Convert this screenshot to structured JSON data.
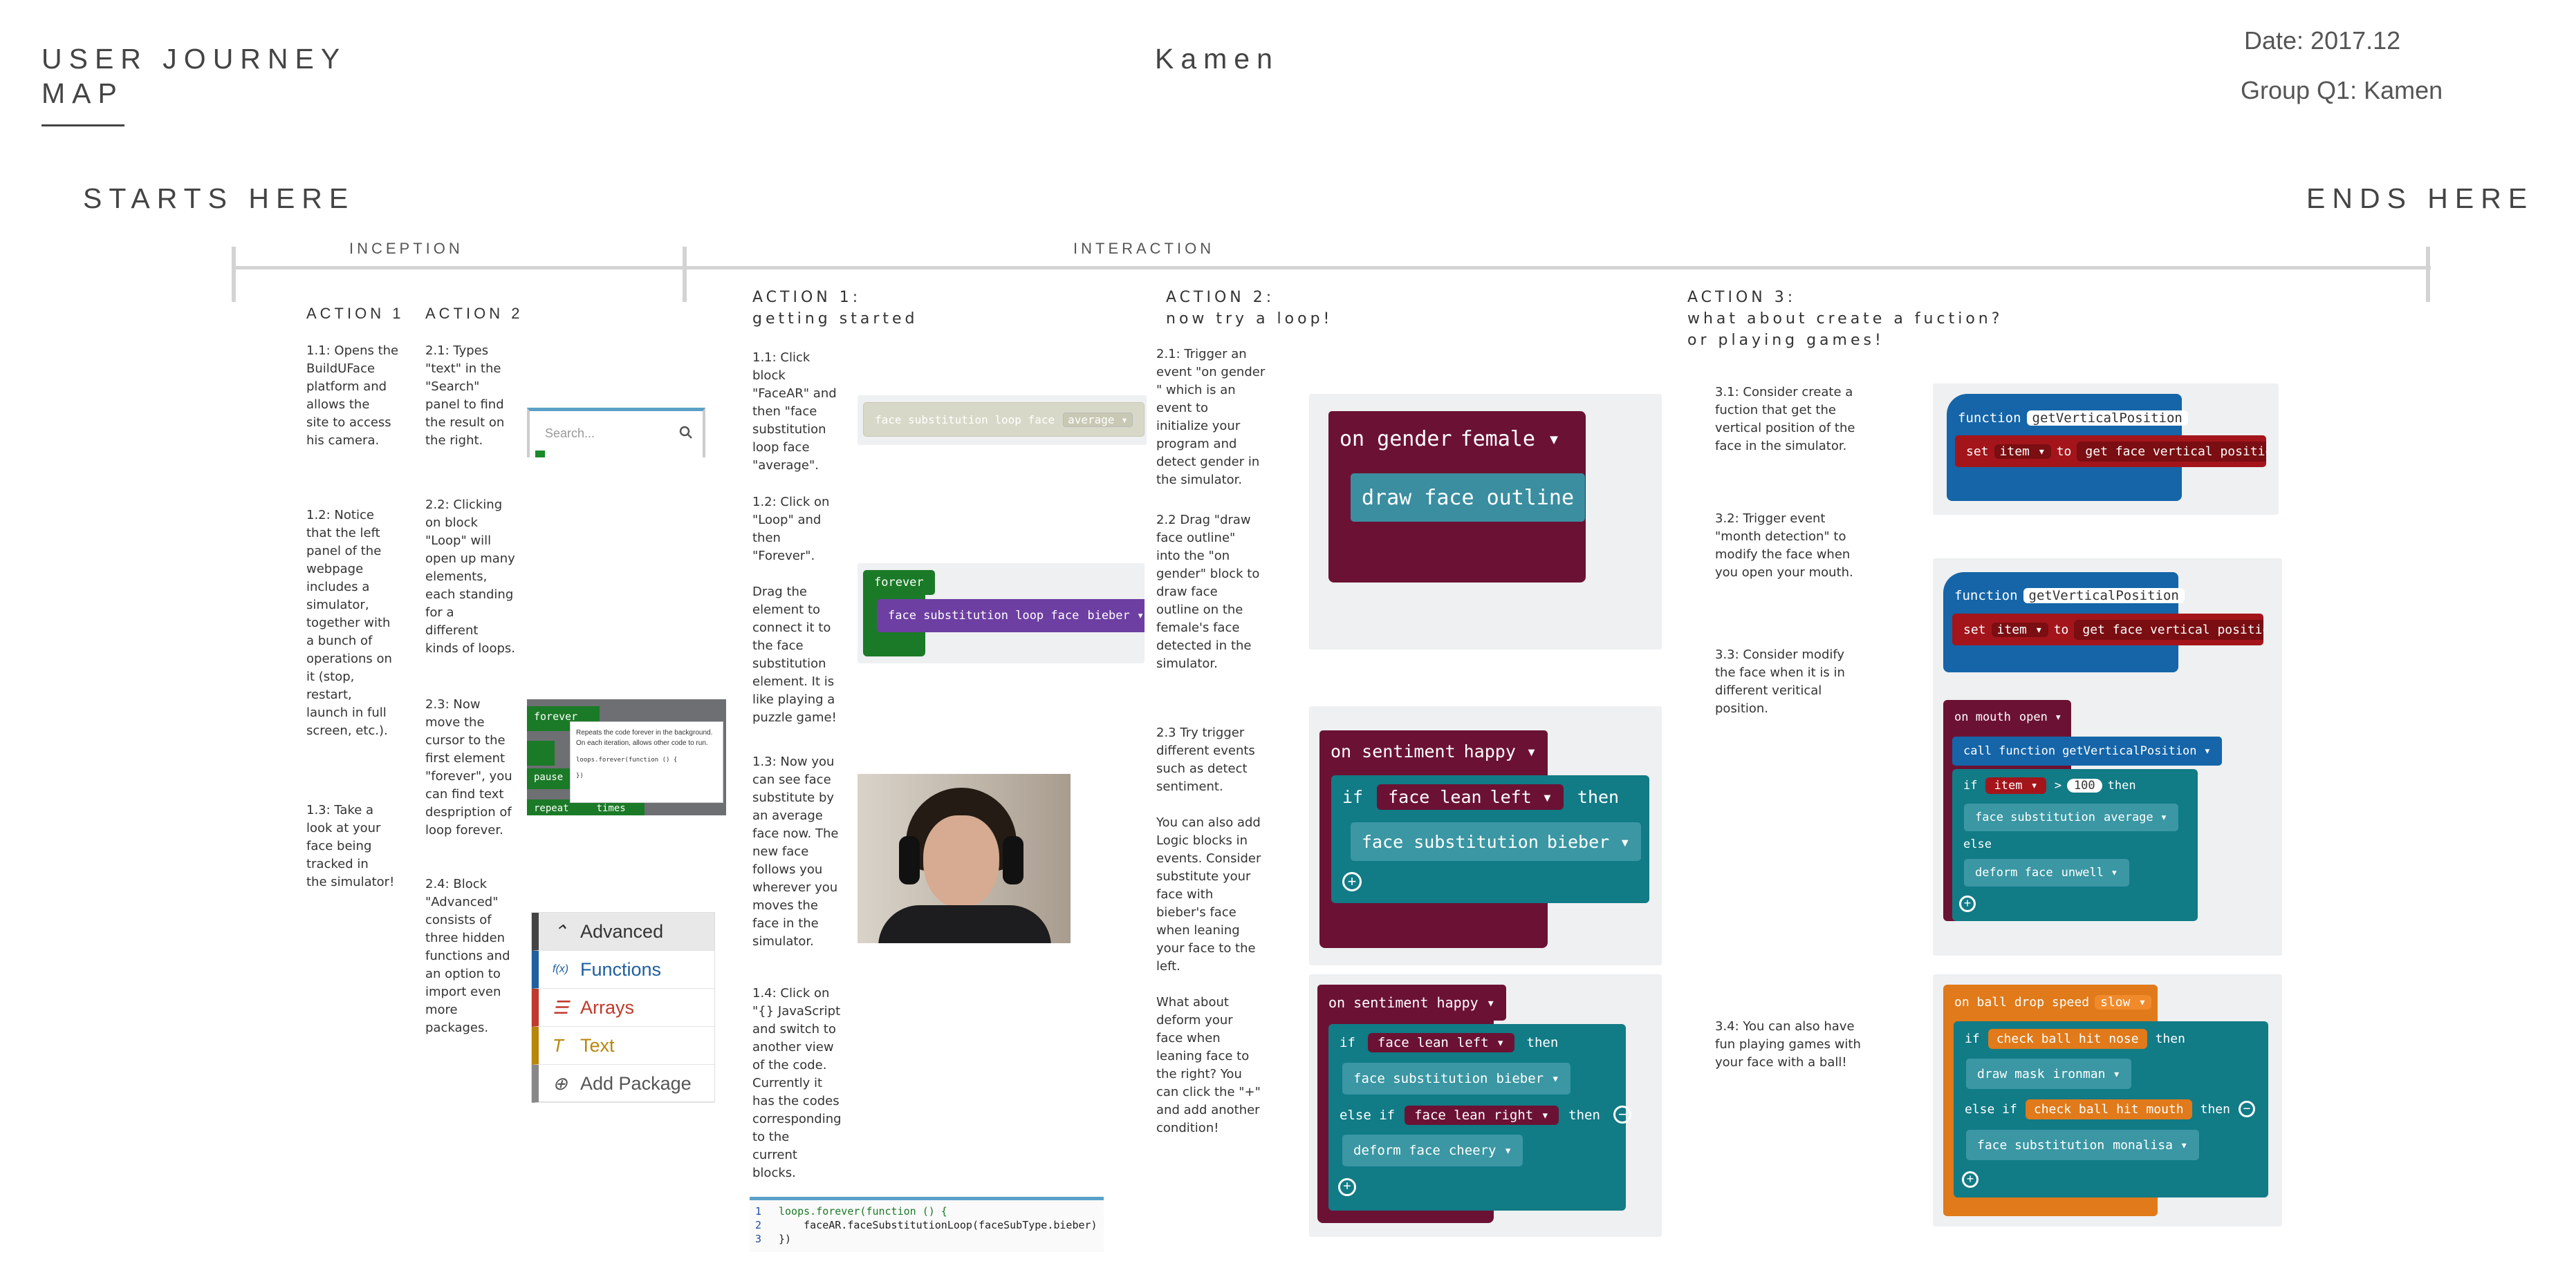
{
  "header": {
    "title": "USER JOURNEY\nMAP",
    "center": "Kamen",
    "date": "Date:   2017.12",
    "group": "Group Q1: Kamen"
  },
  "ends": {
    "start": "STARTS HERE",
    "end": "ENDS HERE"
  },
  "phases": {
    "inception": "INCEPTION",
    "interaction": "INTERACTION"
  },
  "inception": {
    "action1_title": "ACTION 1",
    "action2_title": "ACTION 2",
    "a1_notes": [
      "1.1: Opens the\nBuildUFace\nplatform and\nallows the\nsite to access\nhis camera.",
      "1.2: Notice\nthat the left\npanel of the\nwebpage\nincludes a\nsimulator,\ntogether with\na bunch of\noperations on\nit (stop,\nrestart,\nlaunch in full\nscreen, etc.).",
      "1.3: Take a\nlook at your\nface being\ntracked in\nthe simulator!"
    ],
    "a2_notes": [
      "2.1: Types\n\"text\" in the\n\"Search\"\npanel to find\nthe result on\nthe right.",
      "2.2: Clicking\non block\n\"Loop\" will\nopen up many\nelements,\neach standing\nfor a\ndifferent\nkinds of loops.",
      "2.3: Now\nmove the\ncursor to the\nfirst element\n\"forever\", you\ncan find text\ndespription of\nloop forever.",
      "2.4: Block\n\"Advanced\"\nconsists of\nthree hidden\nfunctions and\nan option to\nimport even\nmore\npackages."
    ],
    "search_placeholder": "Search...",
    "tooltip": {
      "head": "forever",
      "text": "Repeats the code forever in the background. On each iteration, allows other code to run.",
      "code": "loops.forever(function () {",
      "close": "})",
      "labels": [
        "pause",
        "repeat",
        "times"
      ]
    },
    "menu": [
      {
        "icon": "chevron-up-icon",
        "glyph": "⌃",
        "label": "Advanced",
        "color": "#333333",
        "bar": "#444444"
      },
      {
        "icon": "function-icon",
        "glyph": "f(x)",
        "label": "Functions",
        "color": "#1f5fa0",
        "bar": "#1f5fa0"
      },
      {
        "icon": "list-icon",
        "glyph": "☰",
        "label": "Arrays",
        "color": "#c0392b",
        "bar": "#c0392b"
      },
      {
        "icon": "text-icon",
        "glyph": "T",
        "label": "Text",
        "color": "#b8860b",
        "bar": "#b8860b"
      },
      {
        "icon": "add-icon",
        "glyph": "⊕",
        "label": "Add Package",
        "color": "#555555",
        "bar": "#888888"
      }
    ]
  },
  "action1": {
    "title": "ACTION 1:\ngetting started",
    "notes": [
      "1.1: Click\nblock\n\"FaceAR\" and\nthen \"face\nsubstitution\nloop face\n\"average\".",
      "1.2: Click on\n\"Loop\" and\nthen\n\"Forever\".\n\nDrag the\nelement to\nconnect it to\nthe face\nsubstitution\nelement. It is\nlike playing a\npuzzle game!",
      "1.3: Now you\ncan see face\nsubstitute by\nan average\nface now. The\nnew face\nfollows you\nwherever you\nmoves the\nface in the\nsimulator.",
      "1.4: Click on\n\"{} JavaScript\nand switch to\nanother view\nof the code.\nCurrently it\nhas the codes\ncorresponding\nto the\ncurrent\nblocks."
    ],
    "ghost_block": "face substitution loop face",
    "ghost_dd": "average",
    "forever": "forever",
    "loop_block": "face substitution loop face",
    "loop_dd": "bieber",
    "code": [
      {
        "n": "1",
        "text": "loops.forever(function () {"
      },
      {
        "n": "2",
        "text": "    faceAR.faceSubstitutionLoop(faceSubType.bieber)"
      },
      {
        "n": "3",
        "text": "})"
      }
    ]
  },
  "action2": {
    "title": "ACTION 2:\nnow try a loop!",
    "notes": [
      "2.1: Trigger an\nevent \"on gender\n\" which is an\nevent to\ninitialize your\nprogram and\ndetect gender in\nthe simulator.",
      "2.2 Drag \"draw\nface outline\"\ninto the \"on\ngender\" block to\ndraw face\noutline on the\nfemale's face\ndetected in the\nsimulator.",
      "2.3 Try trigger\ndifferent events\nsuch as detect\nsentiment.\n\nYou can also add\nLogic blocks in\nevents. Consider\nsubstitute your\nface with\nbieber's face\nwhen leaning\nyour face to the\nleft.\n\nWhat about\ndeform your\nface when\nleaning face to\nthe right? You\ncan click the \"+\"\nand add another\ncondition!"
    ],
    "p1": {
      "on_gender": "on gender",
      "female": "female",
      "draw": "draw face outline"
    },
    "p2": {
      "on_sentiment": "on sentiment",
      "happy": "happy",
      "if": "if",
      "lean": "face lean",
      "left": "left",
      "then": "then",
      "sub": "face substitution",
      "bieber": "bieber"
    },
    "p3": {
      "on_sentiment": "on sentiment",
      "happy": "happy",
      "if": "if",
      "lean": "face lean",
      "left": "left",
      "then": "then",
      "sub": "face substitution",
      "bieber": "bieber",
      "elseif": "else if",
      "right": "right",
      "deform": "deform face",
      "cheery": "cheery"
    }
  },
  "action3": {
    "title": "ACTION 3:\nwhat about create a fuction?\nor playing games!",
    "notes": [
      "3.1: Consider create a\nfuction that get the\nvertical position of the\nface in the simulator.",
      "3.2: Trigger event\n\"month detection\" to\nmodify the face when\nyou open your mouth.",
      "3.3: Consider modify\nthe face when it is in\ndifferent veritical\nposition.",
      "3.4: You can also have\nfun playing games with\nyour face with a ball!"
    ],
    "fn": {
      "function": "function",
      "name": "getVerticalPosition",
      "set": "set",
      "item": "item",
      "to": "to",
      "get": "get face vertical position"
    },
    "mouth": {
      "on_mouth": "on mouth",
      "open": "open",
      "call": "call function",
      "name": "getVerticalPosition",
      "if": "if",
      "item": "item",
      "op": ">",
      "val": "100",
      "then": "then",
      "sub": "face substitution",
      "average": "average",
      "else": "else",
      "deform": "deform face",
      "unwell": "unwell"
    },
    "ball": {
      "on_ball": "on ball drop speed",
      "slow": "slow",
      "if": "if",
      "hitnose": "check ball hit nose",
      "then": "then",
      "draw": "draw mask",
      "ironman": "ironman",
      "elseif": "else if",
      "hitmouth": "check ball hit mouth",
      "sub": "face substitution",
      "monalisa": "monalisa"
    }
  }
}
